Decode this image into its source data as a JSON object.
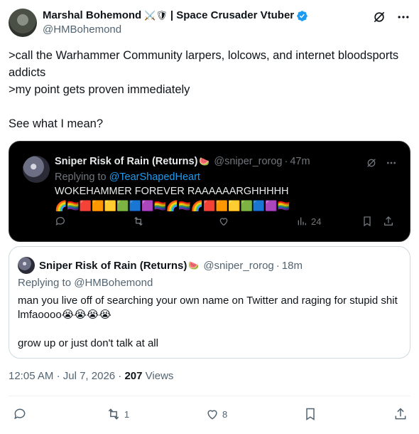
{
  "author": {
    "name": "Marshal Bohemond",
    "name_emoji": "⚔️🛡",
    "name_suffix": "| Space Crusader Vtuber",
    "handle": "@HMBohemond",
    "verified_color": "#1d9bf0"
  },
  "tweet": {
    "lines": [
      ">call the Warhammer Community larpers, lolcows, and internet bloodsports addicts",
      ">my point gets proven immediately",
      "",
      "See what I mean?"
    ]
  },
  "embedded_image": {
    "name": "Sniper Risk of Rain (Returns)",
    "name_emoji": "🍉",
    "handle": "@sniper_rorog",
    "time": "47m",
    "replying_prefix": "Replying to",
    "replying_to": "@TearShapedHeart",
    "body": "WOKEHAMMER FOREVER RAAAAAARGHHHHH",
    "emoji_line": "🌈🏳️‍🌈🟥🟧🟨🟩🟦🟪🏳️‍🌈🌈🏳️‍🌈🌈🟥🟧🟨🟩🟦🟪🏳️‍🌈",
    "views": "24"
  },
  "quote": {
    "name": "Sniper Risk of Rain (Returns)",
    "name_emoji": "🍉",
    "handle": "@sniper_rorog",
    "time": "18m",
    "replying": "Replying to @HMBohemond",
    "body_line1": "man you live off of searching your own name on Twitter and raging for stupid shit lmfaoooo😭😭😭😭",
    "body_line2": "grow up or just don't talk at all"
  },
  "meta": {
    "time": "12:05 AM",
    "date": "Jul 7, 2026",
    "views_count": "207",
    "views_label": "Views"
  },
  "actions": {
    "reply_count": "",
    "retweet_count": "1",
    "like_count": "8"
  }
}
